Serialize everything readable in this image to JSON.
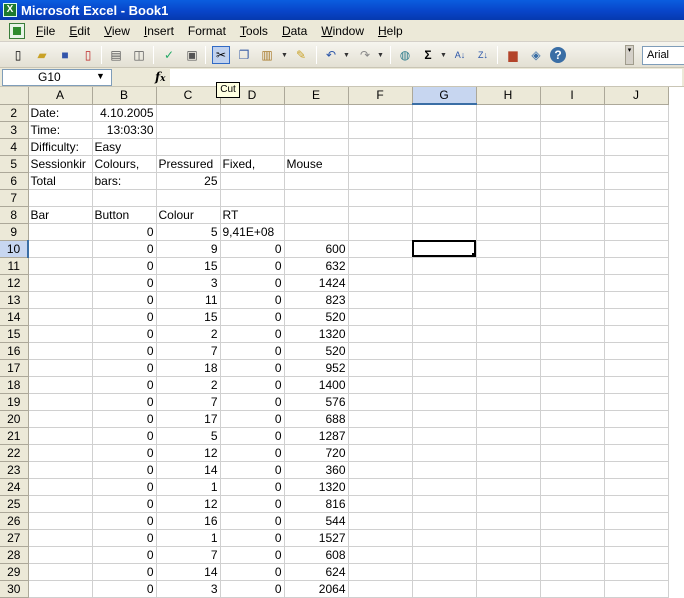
{
  "window": {
    "title": "Microsoft Excel - Book1"
  },
  "menu": [
    {
      "label": "File",
      "key": "F",
      "rest": "ile"
    },
    {
      "label": "Edit",
      "key": "E",
      "rest": "dit"
    },
    {
      "label": "View",
      "key": "V",
      "rest": "iew"
    },
    {
      "label": "Insert",
      "key": "I",
      "rest": "nsert"
    },
    {
      "label": "Format",
      "key": "",
      "rest": "Format"
    },
    {
      "label": "Tools",
      "key": "T",
      "rest": "ools"
    },
    {
      "label": "Data",
      "key": "D",
      "rest": "ata"
    },
    {
      "label": "Window",
      "key": "W",
      "rest": "indow"
    },
    {
      "label": "Help",
      "key": "H",
      "rest": "elp"
    }
  ],
  "toolbar": {
    "font_name": "Arial",
    "tooltip": "Cut",
    "icons": [
      "new-icon",
      "open-icon",
      "save-icon",
      "permission-icon",
      "print-icon",
      "print-preview-icon",
      "spelling-icon",
      "research-icon",
      "cut-icon",
      "copy-icon",
      "paste-icon",
      "format-painter-icon",
      "undo-icon",
      "redo-icon",
      "hyperlink-icon",
      "autosum-icon",
      "sort-ascending-icon",
      "sort-descending-icon",
      "chart-wizard-icon",
      "drawing-icon",
      "help-icon"
    ]
  },
  "formula_bar": {
    "name_box": "G10",
    "fx": "fx",
    "content": ""
  },
  "grid": {
    "columns": [
      "A",
      "B",
      "C",
      "D",
      "E",
      "F",
      "G",
      "H",
      "I",
      "J"
    ],
    "selected_column": "G",
    "selected_row": 10,
    "active_cell": "G10",
    "rows": [
      {
        "n": 2,
        "cells": [
          "Date:",
          "4.10.2005",
          "",
          "",
          "",
          "",
          "",
          "",
          "",
          ""
        ]
      },
      {
        "n": 3,
        "cells": [
          "Time:",
          "13:03:30",
          "",
          "",
          "",
          "",
          "",
          "",
          "",
          ""
        ]
      },
      {
        "n": 4,
        "cells": [
          "Difficulty:",
          "Easy",
          "",
          "",
          "",
          "",
          "",
          "",
          "",
          ""
        ]
      },
      {
        "n": 5,
        "cells": [
          "Sessionkir",
          "Colours,",
          "Pressured",
          "Fixed,",
          "Mouse",
          "",
          "",
          "",
          "",
          ""
        ]
      },
      {
        "n": 6,
        "cells": [
          "Total",
          "bars:",
          "25",
          "",
          "",
          "",
          "",
          "",
          "",
          ""
        ]
      },
      {
        "n": 7,
        "cells": [
          "",
          "",
          "",
          "",
          "",
          "",
          "",
          "",
          "",
          ""
        ]
      },
      {
        "n": 8,
        "cells": [
          "Bar",
          "Button",
          "Colour",
          "RT",
          "",
          "",
          "",
          "",
          "",
          ""
        ]
      },
      {
        "n": 9,
        "cells": [
          "",
          "0",
          "5",
          "9,41E+08",
          "",
          "",
          "",
          "",
          "",
          ""
        ]
      },
      {
        "n": 10,
        "cells": [
          "",
          "0",
          "9",
          "0",
          "600",
          "",
          "",
          "",
          "",
          ""
        ]
      },
      {
        "n": 11,
        "cells": [
          "",
          "0",
          "15",
          "0",
          "632",
          "",
          "",
          "",
          "",
          ""
        ]
      },
      {
        "n": 12,
        "cells": [
          "",
          "0",
          "3",
          "0",
          "1424",
          "",
          "",
          "",
          "",
          ""
        ]
      },
      {
        "n": 13,
        "cells": [
          "",
          "0",
          "11",
          "0",
          "823",
          "",
          "",
          "",
          "",
          ""
        ]
      },
      {
        "n": 14,
        "cells": [
          "",
          "0",
          "15",
          "0",
          "520",
          "",
          "",
          "",
          "",
          ""
        ]
      },
      {
        "n": 15,
        "cells": [
          "",
          "0",
          "2",
          "0",
          "1320",
          "",
          "",
          "",
          "",
          ""
        ]
      },
      {
        "n": 16,
        "cells": [
          "",
          "0",
          "7",
          "0",
          "520",
          "",
          "",
          "",
          "",
          ""
        ]
      },
      {
        "n": 17,
        "cells": [
          "",
          "0",
          "18",
          "0",
          "952",
          "",
          "",
          "",
          "",
          ""
        ]
      },
      {
        "n": 18,
        "cells": [
          "",
          "0",
          "2",
          "0",
          "1400",
          "",
          "",
          "",
          "",
          ""
        ]
      },
      {
        "n": 19,
        "cells": [
          "",
          "0",
          "7",
          "0",
          "576",
          "",
          "",
          "",
          "",
          ""
        ]
      },
      {
        "n": 20,
        "cells": [
          "",
          "0",
          "17",
          "0",
          "688",
          "",
          "",
          "",
          "",
          ""
        ]
      },
      {
        "n": 21,
        "cells": [
          "",
          "0",
          "5",
          "0",
          "1287",
          "",
          "",
          "",
          "",
          ""
        ]
      },
      {
        "n": 22,
        "cells": [
          "",
          "0",
          "12",
          "0",
          "720",
          "",
          "",
          "",
          "",
          ""
        ]
      },
      {
        "n": 23,
        "cells": [
          "",
          "0",
          "14",
          "0",
          "360",
          "",
          "",
          "",
          "",
          ""
        ]
      },
      {
        "n": 24,
        "cells": [
          "",
          "0",
          "1",
          "0",
          "1320",
          "",
          "",
          "",
          "",
          ""
        ]
      },
      {
        "n": 25,
        "cells": [
          "",
          "0",
          "12",
          "0",
          "816",
          "",
          "",
          "",
          "",
          ""
        ]
      },
      {
        "n": 26,
        "cells": [
          "",
          "0",
          "16",
          "0",
          "544",
          "",
          "",
          "",
          "",
          ""
        ]
      },
      {
        "n": 27,
        "cells": [
          "",
          "0",
          "1",
          "0",
          "1527",
          "",
          "",
          "",
          "",
          ""
        ]
      },
      {
        "n": 28,
        "cells": [
          "",
          "0",
          "7",
          "0",
          "608",
          "",
          "",
          "",
          "",
          ""
        ]
      },
      {
        "n": 29,
        "cells": [
          "",
          "0",
          "14",
          "0",
          "624",
          "",
          "",
          "",
          "",
          ""
        ]
      },
      {
        "n": 30,
        "cells": [
          "",
          "0",
          "3",
          "0",
          "2064",
          "",
          "",
          "",
          "",
          ""
        ]
      }
    ]
  }
}
